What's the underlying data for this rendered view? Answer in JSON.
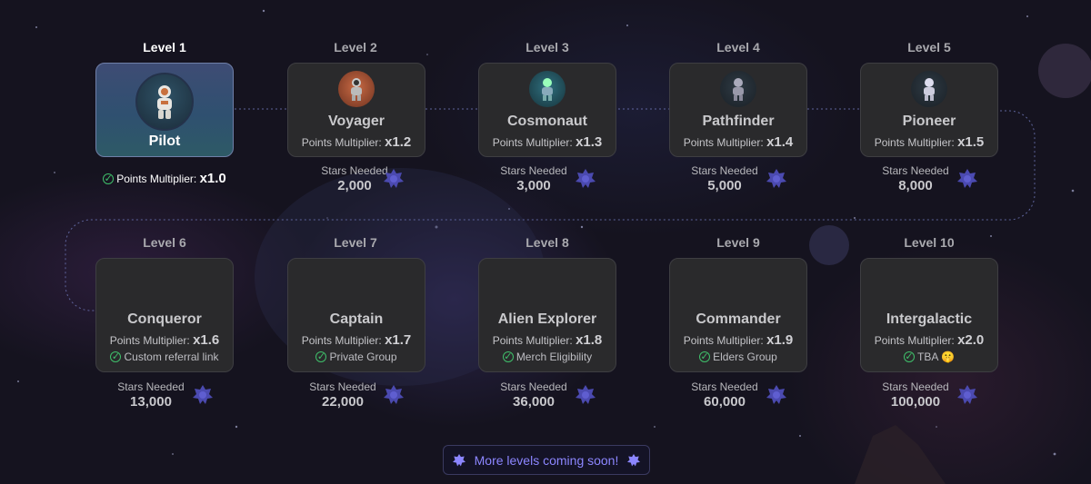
{
  "levels": [
    {
      "label": "Level 1",
      "name": "Pilot",
      "multiplier_label": "Points Multiplier:",
      "multiplier": "x1.0",
      "icon": "astronaut-icon"
    },
    {
      "label": "Level 2",
      "name": "Voyager",
      "multiplier_label": "Points Multiplier:",
      "multiplier": "x1.2",
      "stars_label": "Stars Needed",
      "stars": "2,000",
      "icon": "astronaut-icon"
    },
    {
      "label": "Level 3",
      "name": "Cosmonaut",
      "multiplier_label": "Points Multiplier:",
      "multiplier": "x1.3",
      "stars_label": "Stars Needed",
      "stars": "3,000",
      "icon": "astronaut-icon"
    },
    {
      "label": "Level 4",
      "name": "Pathfinder",
      "multiplier_label": "Points Multiplier:",
      "multiplier": "x1.4",
      "stars_label": "Stars Needed",
      "stars": "5,000",
      "icon": "astronaut-icon"
    },
    {
      "label": "Level 5",
      "name": "Pioneer",
      "multiplier_label": "Points Multiplier:",
      "multiplier": "x1.5",
      "stars_label": "Stars Needed",
      "stars": "8,000",
      "icon": "astronaut-icon"
    },
    {
      "label": "Level 6",
      "name": "Conqueror",
      "multiplier_label": "Points Multiplier:",
      "multiplier": "x1.6",
      "perk": "Custom referral link",
      "stars_label": "Stars Needed",
      "stars": "13,000"
    },
    {
      "label": "Level 7",
      "name": "Captain",
      "multiplier_label": "Points Multiplier:",
      "multiplier": "x1.7",
      "perk": "Private Group",
      "stars_label": "Stars Needed",
      "stars": "22,000"
    },
    {
      "label": "Level 8",
      "name": "Alien Explorer",
      "multiplier_label": "Points Multiplier:",
      "multiplier": "x1.8",
      "perk": "Merch Eligibility",
      "stars_label": "Stars Needed",
      "stars": "36,000"
    },
    {
      "label": "Level 9",
      "name": "Commander",
      "multiplier_label": "Points Multiplier:",
      "multiplier": "x1.9",
      "perk": "Elders Group",
      "stars_label": "Stars Needed",
      "stars": "60,000"
    },
    {
      "label": "Level 10",
      "name": "Intergalactic",
      "multiplier_label": "Points Multiplier:",
      "multiplier": "x2.0",
      "perk": "TBA 🤫",
      "stars_label": "Stars Needed",
      "stars": "100,000"
    }
  ],
  "footer": {
    "more_levels": "More levels coming soon!"
  },
  "colors": {
    "accent": "#8c86ff",
    "check": "#3fbf6a",
    "card": "#2a2a2c",
    "active_card": "#3e4c74"
  }
}
